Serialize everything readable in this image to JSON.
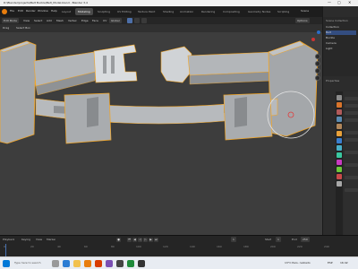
{
  "window": {
    "title": "D:\\Blender\\projects\\Belt Buckle\\Belt_Model.blend - Blender 3.4",
    "controls": {
      "minimize": "—",
      "maximize": "▢",
      "close": "✕"
    }
  },
  "menubar": {
    "menus": [
      "File",
      "Edit",
      "Render",
      "Window",
      "Help"
    ],
    "tabs": [
      "Layout",
      "Modeling",
      "Sculpting",
      "UV Editing",
      "Texture Paint",
      "Shading",
      "Animation",
      "Rendering",
      "Compositing",
      "Geometry Nodes",
      "Scripting"
    ],
    "active_tab": "Modeling",
    "scene_label": "Scene",
    "viewlayer_label": "ViewLayer"
  },
  "header": {
    "mode": "Edit Mode",
    "view": "View",
    "select": "Select",
    "add": "Add",
    "mesh": "Mesh",
    "vertex": "Vertex",
    "edge": "Edge",
    "face": "Face",
    "uv": "UV",
    "transform": "Global",
    "options": "Options"
  },
  "subheader": {
    "orientation": "Global",
    "items": [
      "Drag",
      "Select Box"
    ]
  },
  "viewport": {
    "mesh_edge_color": "#f5a623",
    "mesh_face_color": "#9ea2a5",
    "gizmo_axes": [
      "X",
      "Y",
      "Z"
    ]
  },
  "outliner": {
    "header": "Scene Collection",
    "rows": [
      "Collection",
      "Belt",
      "Buckle",
      "Camera",
      "Light"
    ],
    "selected_row": 1
  },
  "properties": {
    "label": "Properties"
  },
  "timeline": {
    "playback": "Playback",
    "keying": "Keying",
    "view": "View",
    "marker": "Marker",
    "start_label": "Start",
    "start": "1",
    "end_label": "End",
    "end": "250",
    "current_frame": "1",
    "ticks": [
      "0",
      "20",
      "40",
      "60",
      "80",
      "100",
      "120",
      "140",
      "160",
      "180",
      "200",
      "220",
      "240"
    ]
  },
  "taskbar": {
    "search_placeholder": "Type here to search",
    "weather": "13°C Pers. nublado",
    "lang": "ESP",
    "time": "16:42"
  }
}
